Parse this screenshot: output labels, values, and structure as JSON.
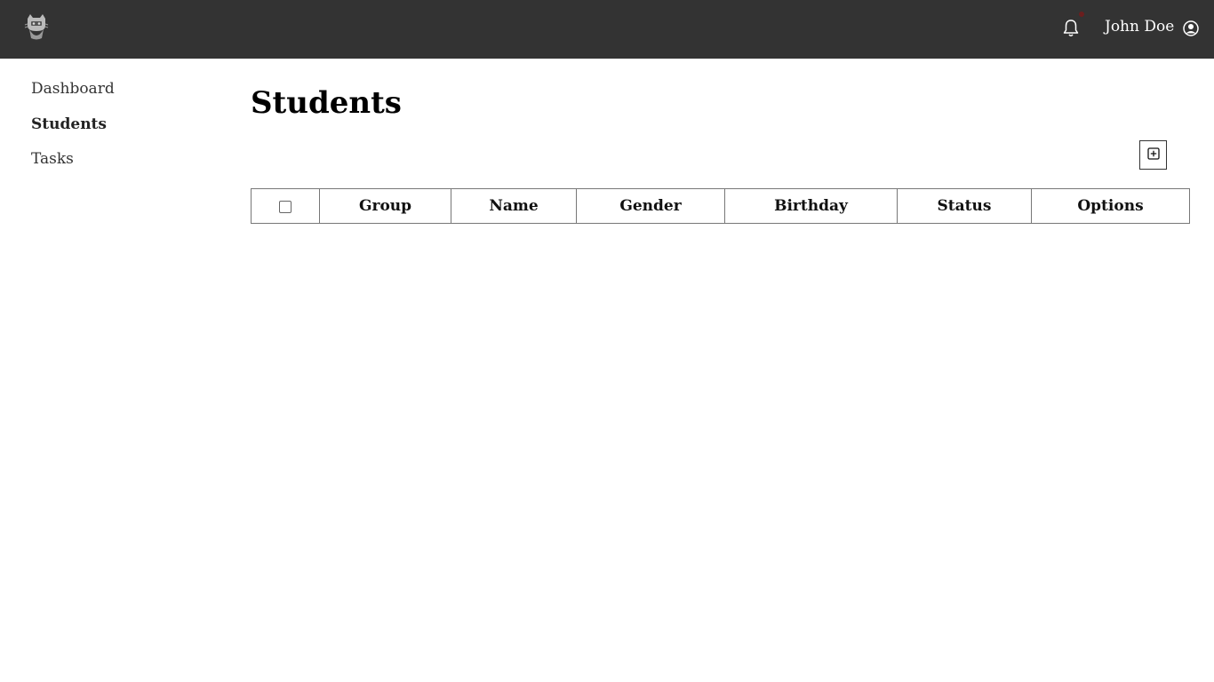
{
  "header": {
    "logo_icon": "cat-mascot-logo",
    "notification_icon": "bell-icon",
    "notification_dot_color": "#6b1e1e",
    "user_name": "John Doe",
    "user_icon": "user-circle-icon",
    "background_color": "#333333"
  },
  "sidebar": {
    "items": [
      {
        "label": "Dashboard",
        "active": false
      },
      {
        "label": "Students",
        "active": true
      },
      {
        "label": "Tasks",
        "active": false
      }
    ]
  },
  "main": {
    "title": "Students",
    "add_button_icon": "plus-square-icon",
    "table": {
      "columns": [
        "Group",
        "Name",
        "Gender",
        "Birthday",
        "Status",
        "Options"
      ],
      "rows": []
    }
  }
}
